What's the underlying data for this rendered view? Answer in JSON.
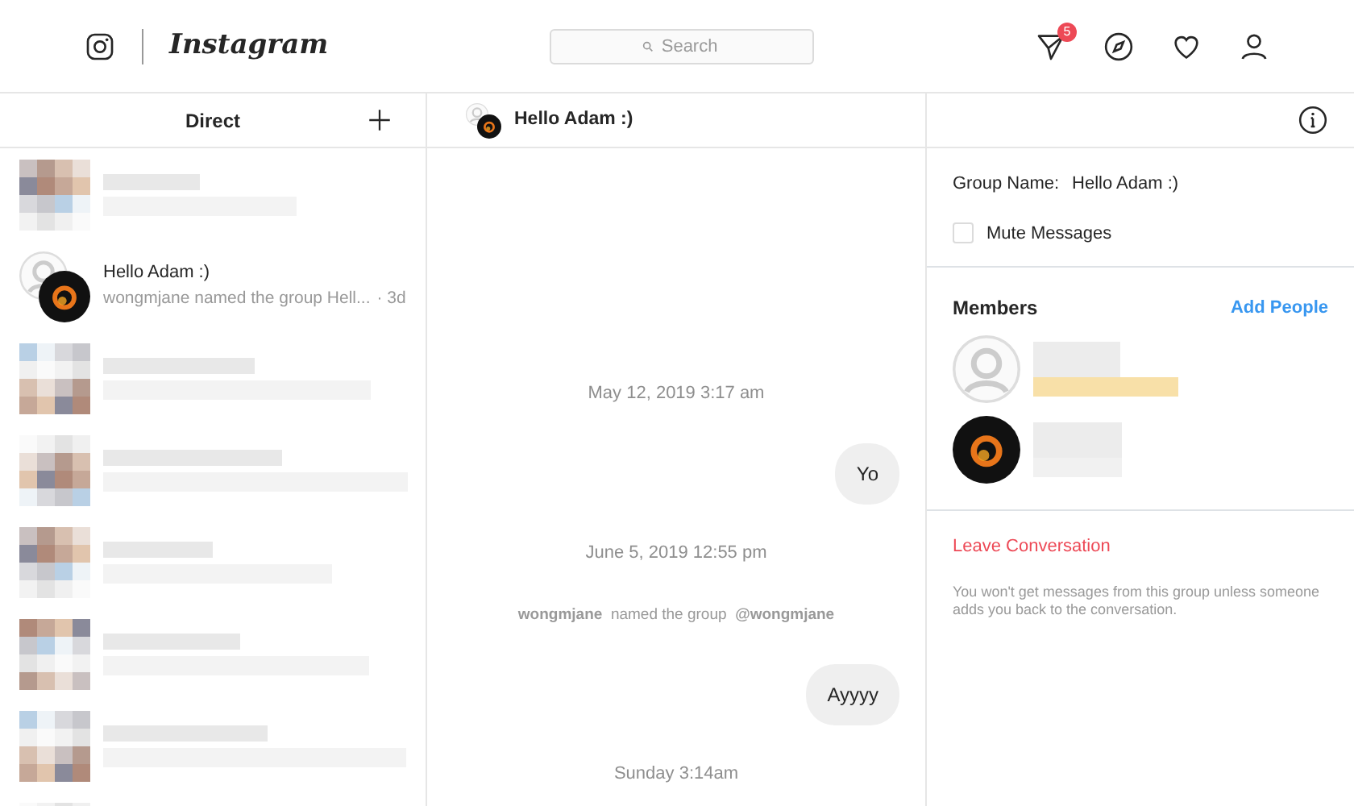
{
  "header": {
    "logo": "Instagram",
    "search": {
      "placeholder": "Search"
    },
    "notification_count": "5"
  },
  "sidebar": {
    "title": "Direct",
    "threads": [
      {
        "kind": "redacted"
      },
      {
        "kind": "thread",
        "title": "Hello Adam :)",
        "preview": "wongmjane named the group Hell...",
        "time": "· 3d"
      },
      {
        "kind": "redacted"
      },
      {
        "kind": "redacted"
      },
      {
        "kind": "redacted"
      },
      {
        "kind": "redacted"
      },
      {
        "kind": "redacted"
      },
      {
        "kind": "redacted"
      }
    ]
  },
  "conversation": {
    "title": "Hello Adam :)",
    "messages": [
      {
        "kind": "timestamp",
        "text": "May 12, 2019 3:17 am"
      },
      {
        "kind": "bubble",
        "text": "Yo"
      },
      {
        "kind": "timestamp",
        "text": "June 5, 2019 12:55 pm"
      },
      {
        "kind": "event",
        "text": "**wongmjane**  named the group  **@wongmjane**"
      },
      {
        "kind": "bubble",
        "text": "Ayyyy"
      },
      {
        "kind": "timestamp",
        "text": "Sunday 3:14am"
      }
    ]
  },
  "details": {
    "group_name_label": "Group Name:",
    "group_name": "Hello Adam :)",
    "mute": {
      "label": "Mute Messages",
      "checked": false
    },
    "members_title": "Members",
    "add_people": "Add People",
    "members": [
      {
        "kind": "redacted",
        "photo": false
      },
      {
        "kind": "redacted",
        "photo": true
      }
    ],
    "leave": "Leave Conversation",
    "leave_note": "You won't get messages from this group unless someone adds you back to the conversation."
  }
}
